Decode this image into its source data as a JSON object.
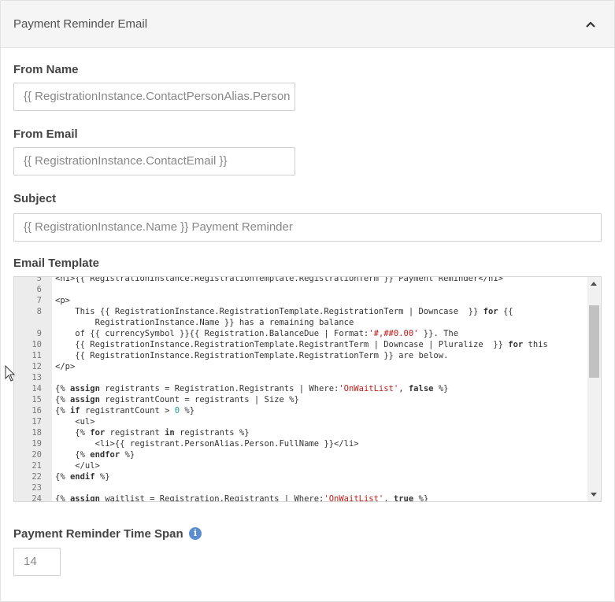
{
  "panel": {
    "title": "Payment Reminder Email"
  },
  "fields": {
    "from_name": {
      "label": "From Name",
      "value": "{{ RegistrationInstance.ContactPersonAlias.Person"
    },
    "from_email": {
      "label": "From Email",
      "value": "{{ RegistrationInstance.ContactEmail }}"
    },
    "subject": {
      "label": "Subject",
      "value": "{{ RegistrationInstance.Name }} Payment Reminder"
    },
    "email_template": {
      "label": "Email Template"
    },
    "time_span": {
      "label": "Payment Reminder Time Span",
      "value": "14"
    }
  },
  "editor": {
    "lines": [
      {
        "n": "5",
        "text": "<h1>{{ RegistrationInstance.RegistrationTemplate.RegistrationTerm }} Payment Reminder</h1>"
      },
      {
        "n": "6",
        "text": ""
      },
      {
        "n": "7",
        "text": "<p>"
      },
      {
        "n": "8",
        "text": "    This {{ RegistrationInstance.RegistrationTemplate.RegistrationTerm | Downcase  }} for {{"
      },
      {
        "n": "",
        "text": "        RegistrationInstance.Name }} has a remaining balance"
      },
      {
        "n": "9",
        "text": "    of {{ currencySymbol }}{{ Registration.BalanceDue | Format:'#,##0.00' }}. The"
      },
      {
        "n": "10",
        "text": "    {{ RegistrationInstance.RegistrationTemplate.RegistrantTerm | Downcase | Pluralize  }} for this"
      },
      {
        "n": "11",
        "text": "    {{ RegistrationInstance.RegistrationTemplate.RegistrationTerm }} are below."
      },
      {
        "n": "12",
        "text": "</p>"
      },
      {
        "n": "13",
        "text": ""
      },
      {
        "n": "14",
        "text": "{% assign registrants = Registration.Registrants | Where:'OnWaitList', false %}"
      },
      {
        "n": "15",
        "text": "{% assign registrantCount = registrants | Size %}"
      },
      {
        "n": "16",
        "text": "{% if registrantCount > 0 %}"
      },
      {
        "n": "17",
        "text": "    <ul>"
      },
      {
        "n": "18",
        "text": "    {% for registrant in registrants %}"
      },
      {
        "n": "19",
        "text": "        <li>{{ registrant.PersonAlias.Person.FullName }}</li>"
      },
      {
        "n": "20",
        "text": "    {% endfor %}"
      },
      {
        "n": "21",
        "text": "    </ul>"
      },
      {
        "n": "22",
        "text": "{% endif %}"
      },
      {
        "n": "23",
        "text": ""
      },
      {
        "n": "24",
        "text": "{% assign waitlist = Registration.Registrants | Where:'OnWaitList', true %}"
      }
    ]
  },
  "colors": {
    "info_icon": "#5a8ed0",
    "string": "#c41a16",
    "number": "#1c9b96"
  },
  "icons": {
    "collapse": "chevron-up-icon",
    "info": "info-icon"
  }
}
